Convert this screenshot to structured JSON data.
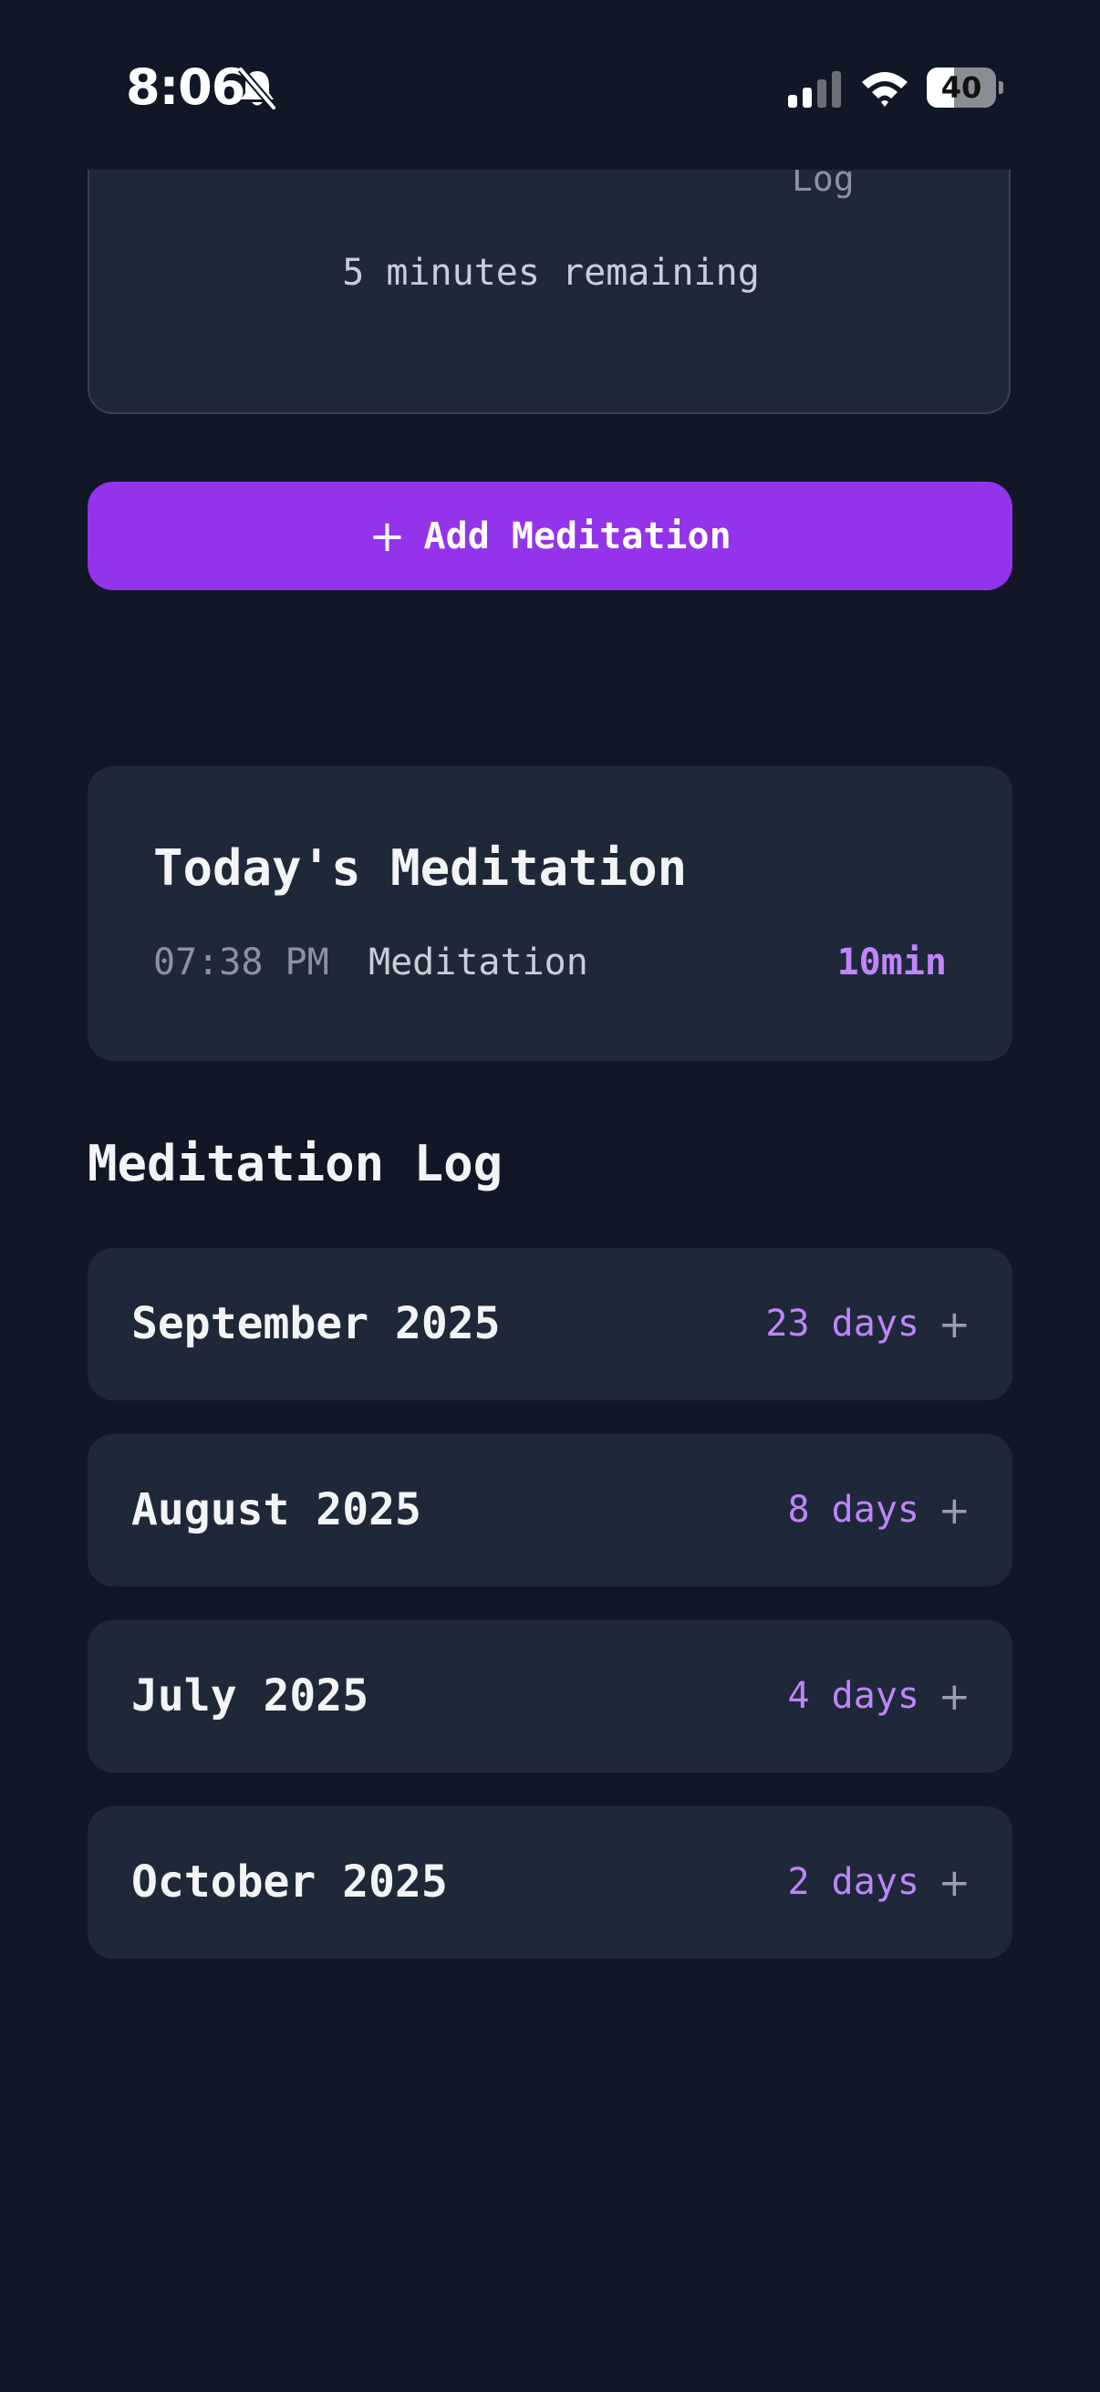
{
  "status_bar": {
    "time": "8:06",
    "battery_level": "40",
    "icons": [
      "bell-slash-icon",
      "cellular-signal-icon",
      "wifi-icon",
      "battery-icon"
    ]
  },
  "timer": {
    "log_label": "Log",
    "remaining": "5 minutes remaining"
  },
  "add_button": {
    "icon": "plus-icon",
    "label": "Add Meditation"
  },
  "today": {
    "title": "Today's Meditation",
    "entries": [
      {
        "time": "07:38 PM",
        "name": "Meditation",
        "duration": "10min"
      }
    ]
  },
  "log": {
    "title": "Meditation Log",
    "months": [
      {
        "name": "September 2025",
        "days": "23 days",
        "expand": "+"
      },
      {
        "name": "August 2025",
        "days": "8 days",
        "expand": "+"
      },
      {
        "name": "July 2025",
        "days": "4 days",
        "expand": "+"
      },
      {
        "name": "October 2025",
        "days": "2 days",
        "expand": "+"
      }
    ]
  },
  "colors": {
    "background": "#121727",
    "card": "#1f2839",
    "accent": "#9333ea",
    "accent_text": "#c084fc"
  }
}
